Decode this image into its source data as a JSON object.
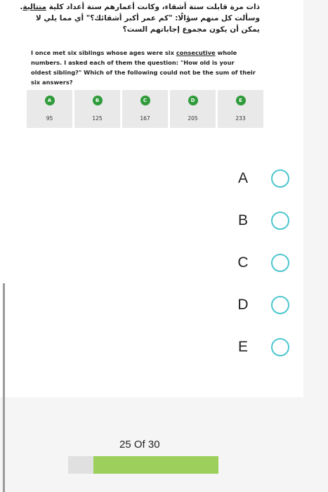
{
  "question": {
    "arabic_before": "ذات مرة قابلت ستة أشقاء، وكانت أعمارهم ستة أعداد كلية ",
    "arabic_underlined": "متتالية",
    "arabic_after": ". وسألت كل منهم سؤالًا: \"كم عمر أكبر أشقائك؟\" أي مما يلي لا يمكن أن يكون مجموع إجاباتهم الست؟",
    "english_before": "I once met six siblings whose ages were six ",
    "english_underlined": "consecutive",
    "english_after": " whole numbers. I asked each of them the question: \"How old is your oldest sibling?\" Which of the following could not be the sum of their six answers?"
  },
  "choices": [
    {
      "letter": "A",
      "value": "95"
    },
    {
      "letter": "B",
      "value": "125"
    },
    {
      "letter": "C",
      "value": "167"
    },
    {
      "letter": "D",
      "value": "205"
    },
    {
      "letter": "E",
      "value": "233"
    }
  ],
  "answer_options": [
    "A",
    "B",
    "C",
    "D",
    "E"
  ],
  "progress": {
    "label": "25 Of 30",
    "fraction": 0.8333
  },
  "colors": {
    "badge_green": "#2f9b3a",
    "radio_border": "#4dc6cf",
    "progress_fill": "#9ccf5b",
    "progress_track": "#e0e0e0"
  }
}
